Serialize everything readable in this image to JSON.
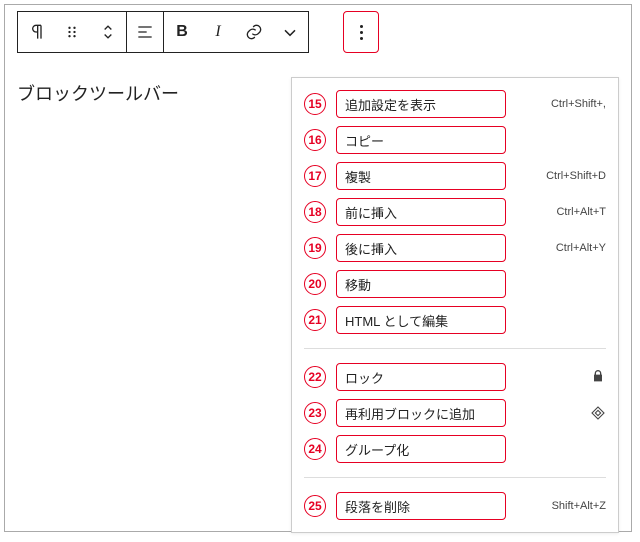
{
  "heading": "ブロックツールバー",
  "toolbar": {
    "block_type": "paragraph",
    "drag": "drag",
    "move": "move",
    "align": "align",
    "bold": "B",
    "italic": "I",
    "link": "link",
    "more_rich": "more",
    "options": "options"
  },
  "menu": {
    "sections": [
      [
        {
          "num": "15",
          "label": "追加設定を表示",
          "shortcut": "Ctrl+Shift+,"
        },
        {
          "num": "16",
          "label": "コピー",
          "shortcut": ""
        },
        {
          "num": "17",
          "label": "複製",
          "shortcut": "Ctrl+Shift+D"
        },
        {
          "num": "18",
          "label": "前に挿入",
          "shortcut": "Ctrl+Alt+T"
        },
        {
          "num": "19",
          "label": "後に挿入",
          "shortcut": "Ctrl+Alt+Y"
        },
        {
          "num": "20",
          "label": "移動",
          "shortcut": ""
        },
        {
          "num": "21",
          "label": "HTML として編集",
          "shortcut": ""
        }
      ],
      [
        {
          "num": "22",
          "label": "ロック",
          "icon": "lock"
        },
        {
          "num": "23",
          "label": "再利用ブロックに追加",
          "icon": "diamond"
        },
        {
          "num": "24",
          "label": "グループ化",
          "shortcut": ""
        }
      ],
      [
        {
          "num": "25",
          "label": "段落を削除",
          "shortcut": "Shift+Alt+Z"
        }
      ]
    ]
  }
}
